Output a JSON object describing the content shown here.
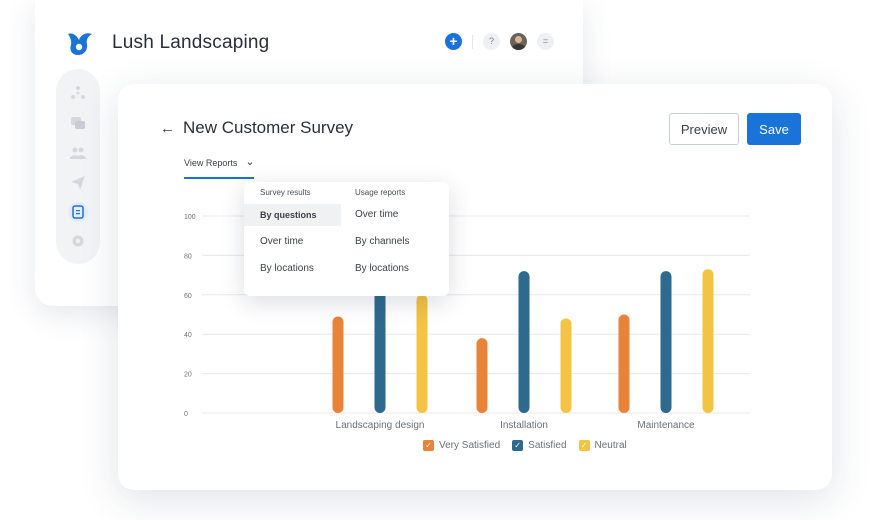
{
  "app": {
    "name": "Lush Landscaping"
  },
  "colors": {
    "accent": "#1a73d9",
    "very_satisfied": "#e8843a",
    "satisfied": "#2e6a8e",
    "neutral": "#f3c343"
  },
  "topbar": {
    "help_icon": "?",
    "menu_icon": "="
  },
  "page": {
    "back": "←",
    "title": "New Customer Survey",
    "preview_label": "Preview",
    "save_label": "Save"
  },
  "view": {
    "label": "View Reports",
    "chevron": "⌄"
  },
  "dropdown": {
    "survey_header": "Survey results",
    "survey_items": [
      "By questions",
      "Over time",
      "By locations"
    ],
    "usage_header": "Usage reports",
    "usage_items": [
      "Over time",
      "By channels",
      "By locations"
    ]
  },
  "legend": [
    {
      "label": "Very Satisfied"
    },
    {
      "label": "Satisfied"
    },
    {
      "label": "Neutral"
    }
  ],
  "chart_data": {
    "type": "bar",
    "categories": [
      "Landscaping design",
      "Installation",
      "Maintenance"
    ],
    "series": [
      {
        "name": "Very Satisfied",
        "values": [
          49,
          38,
          50
        ]
      },
      {
        "name": "Satisfied",
        "values": [
          62,
          72,
          72
        ]
      },
      {
        "name": "Neutral",
        "values": [
          60,
          48,
          73
        ]
      }
    ],
    "yticks": [
      0,
      20,
      40,
      60,
      80,
      100
    ],
    "ylim": [
      0,
      100
    ],
    "grid": true,
    "legend_position": "bottom"
  }
}
